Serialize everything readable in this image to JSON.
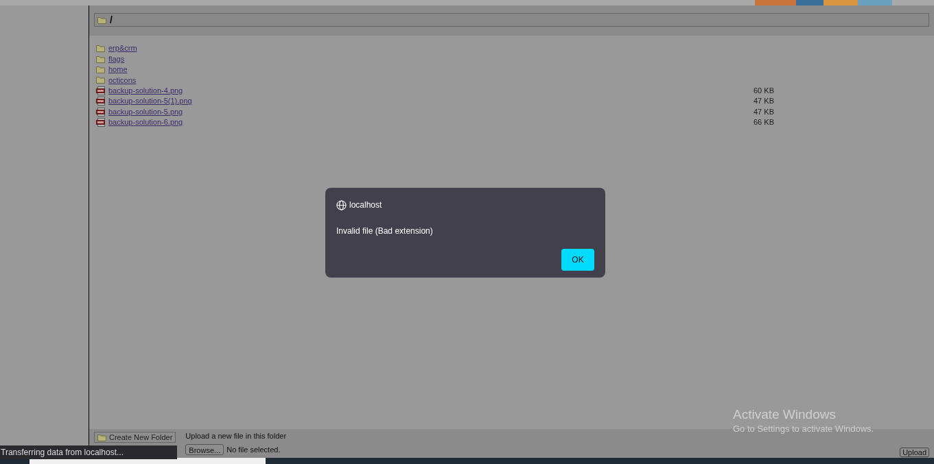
{
  "path": "/",
  "items": [
    {
      "kind": "folder",
      "name": "erp&crm"
    },
    {
      "kind": "folder",
      "name": "flags"
    },
    {
      "kind": "folder",
      "name": "home"
    },
    {
      "kind": "folder",
      "name": "octicons"
    },
    {
      "kind": "file",
      "name": "backup-solution-4.png",
      "size": "60 KB"
    },
    {
      "kind": "file",
      "name": "backup-solution-5(1).png",
      "size": "47 KB"
    },
    {
      "kind": "file",
      "name": "backup-solution-5.png",
      "size": "47 KB"
    },
    {
      "kind": "file",
      "name": "backup-solution-6.png",
      "size": "66 KB"
    }
  ],
  "footer": {
    "create_folder": "Create New Folder",
    "upload_label": "Upload a new file in this folder",
    "browse": "Browse...",
    "no_file": "No file selected.",
    "upload": "Upload"
  },
  "status": "Transferring data from localhost...",
  "dialog": {
    "title": "localhost",
    "message": "Invalid file (Bad extension)",
    "ok": "OK"
  },
  "os_notice": {
    "title": "Activate Windows",
    "subtitle": "Go to Settings to activate Windows."
  }
}
